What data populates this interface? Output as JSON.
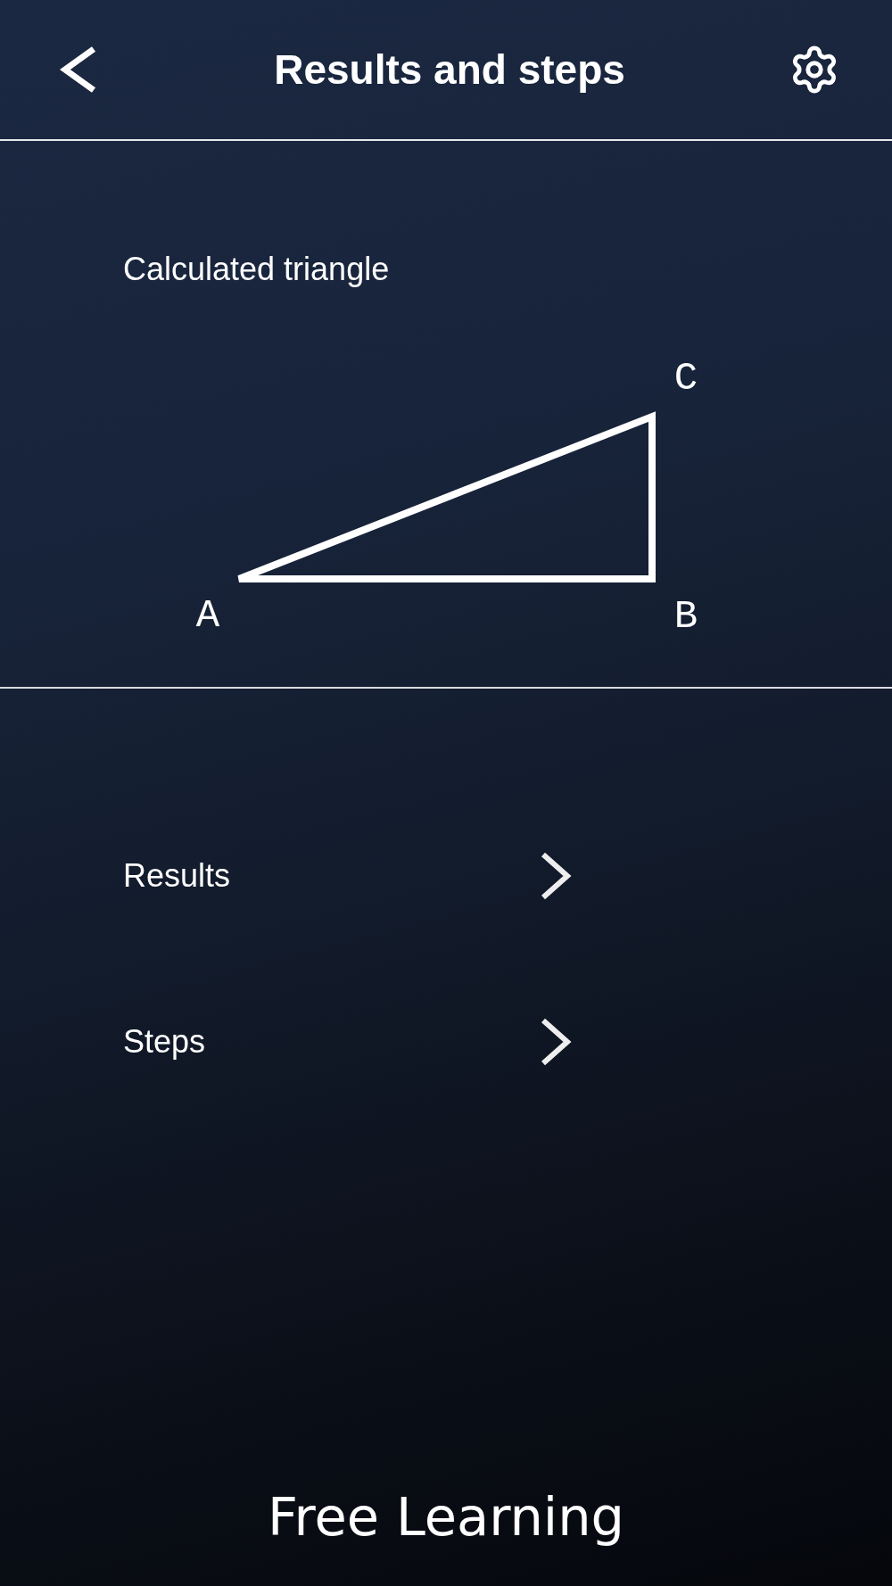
{
  "header": {
    "title": "Results and steps"
  },
  "triangle_panel": {
    "caption": "Calculated triangle",
    "vertices": [
      {
        "label": "A"
      },
      {
        "label": "B"
      },
      {
        "label": "C"
      }
    ]
  },
  "menu": [
    {
      "label": "Results"
    },
    {
      "label": "Steps"
    }
  ],
  "footer": {
    "logo": "Free Learning"
  }
}
